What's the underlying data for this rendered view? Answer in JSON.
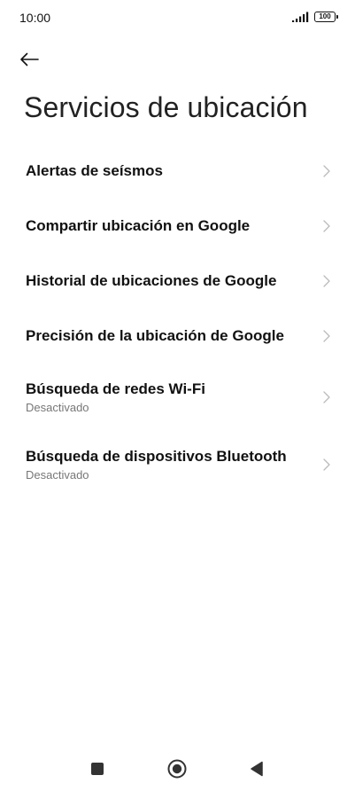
{
  "status_bar": {
    "time": "10:00",
    "battery": "100"
  },
  "header": {
    "title": "Servicios de ubicación",
    "back_icon": "arrow-left-icon"
  },
  "settings": {
    "items": [
      {
        "label": "Alertas de seísmos"
      },
      {
        "label": "Compartir ubicación en Google"
      },
      {
        "label": "Historial de ubicaciones de Google"
      },
      {
        "label": "Precisión de la ubicación de Google"
      },
      {
        "label": "Búsqueda de redes Wi-Fi",
        "subtitle": "Desactivado"
      },
      {
        "label": "Búsqueda de dispositivos Bluetooth",
        "subtitle": "Desactivado"
      }
    ],
    "chevron_icon": "chevron-right-icon"
  },
  "nav_bar": {
    "recents_icon": "square-icon",
    "home_icon": "circle-icon",
    "back_icon": "triangle-back-icon"
  },
  "colors": {
    "text_primary": "#111111",
    "text_secondary": "#777777",
    "chevron": "#bbbbbb",
    "background": "#ffffff"
  }
}
